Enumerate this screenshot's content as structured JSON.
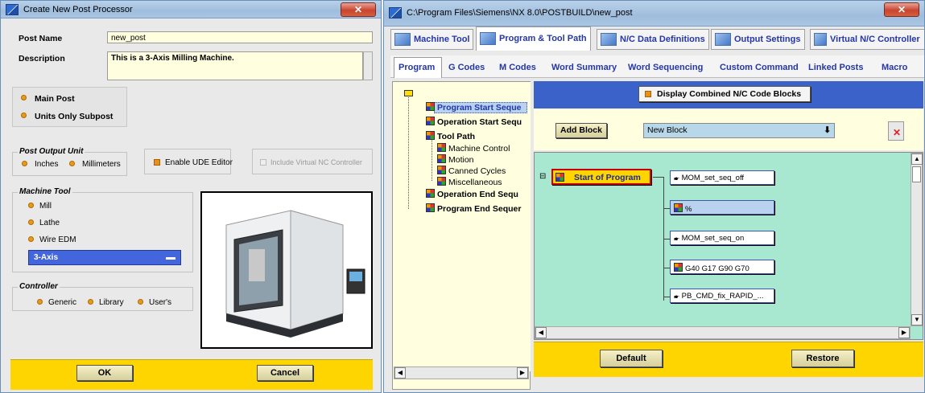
{
  "dialog": {
    "title": "Create New Post Processor",
    "post_name_label": "Post Name",
    "post_name_value": "new_post",
    "description_label": "Description",
    "description_value": "This is a 3-Axis Milling Machine.",
    "main_post": "Main Post",
    "units_only_subpost": "Units Only Subpost",
    "post_output_unit": {
      "title": "Post Output Unit",
      "inches": "Inches",
      "millimeters": "Millimeters"
    },
    "enable_ude": "Enable UDE Editor",
    "include_vnc": "Include Virtual NC Controller",
    "machine_tool": {
      "title": "Machine Tool",
      "mill": "Mill",
      "lathe": "Lathe",
      "wire_edm": "Wire EDM",
      "selected_axis": "3-Axis"
    },
    "controller": {
      "title": "Controller",
      "generic": "Generic",
      "library": "Library",
      "users": "User's"
    },
    "ok": "OK",
    "cancel": "Cancel"
  },
  "editor": {
    "title": "C:\\Program Files\\Siemens\\NX 8.0\\POSTBUILD\\new_post",
    "tabs": [
      "Machine Tool",
      "Program & Tool Path",
      "N/C Data Definitions",
      "Output Settings",
      "Virtual N/C Controller"
    ],
    "subtabs": [
      "Program",
      "G Codes",
      "M Codes",
      "Word Summary",
      "Word Sequencing",
      "Custom Command",
      "Linked Posts",
      "Macro"
    ],
    "tree": {
      "program_start": "Program Start Seque",
      "operation_start": "Operation Start Sequ",
      "tool_path": "Tool Path",
      "machine_control": "Machine Control",
      "motion": "Motion",
      "canned_cycles": "Canned Cycles",
      "miscellaneous": "Miscellaneous",
      "operation_end": "Operation End Sequ",
      "program_end": "Program End Sequer"
    },
    "display_combined": "Display Combined N/C Code Blocks",
    "add_block": "Add Block",
    "new_block": "New Block",
    "start_of_program": "Start of Program",
    "blocks": [
      "MOM_set_seq_off",
      "%",
      "MOM_set_seq_on",
      "G40 G17 G90 G70",
      "PB_CMD_fix_RAPID_..."
    ],
    "default": "Default",
    "restore": "Restore"
  },
  "colors": {
    "accent_yellow": "#ffd500",
    "canvas_green": "#a8e8d0",
    "header_blue": "#3a62c8",
    "selected_blue": "#4466dd"
  }
}
